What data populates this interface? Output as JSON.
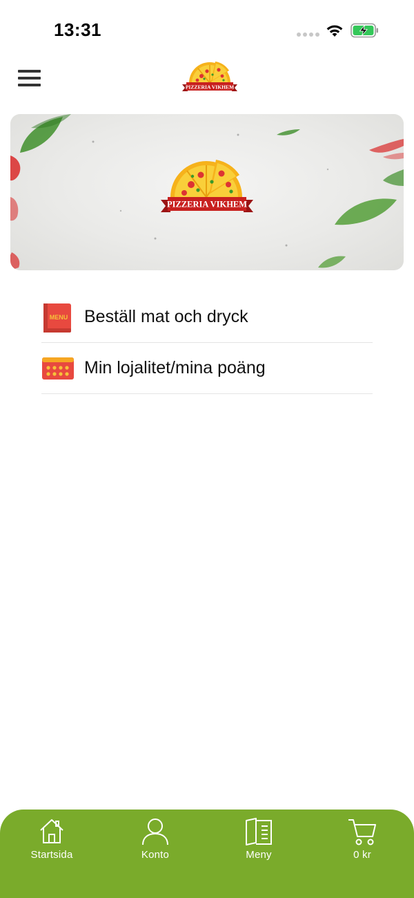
{
  "status_bar": {
    "time": "13:31"
  },
  "header": {
    "logo_text": "PIZZERIA VIKHEM"
  },
  "banner": {
    "logo_text": "PIZZERIA VIKHEM"
  },
  "menu": {
    "items": [
      {
        "label": "Beställ mat och dryck",
        "icon": "menu-book-icon",
        "icon_text": "MENU"
      },
      {
        "label": "Min lojalitet/mina poäng",
        "icon": "loyalty-card-icon"
      }
    ]
  },
  "tab_bar": {
    "background": "#7aab2b",
    "tabs": [
      {
        "label": "Startsida",
        "icon": "home-icon"
      },
      {
        "label": "Konto",
        "icon": "user-icon"
      },
      {
        "label": "Meny",
        "icon": "menu-icon"
      },
      {
        "label": "0 kr",
        "icon": "cart-icon"
      }
    ]
  }
}
